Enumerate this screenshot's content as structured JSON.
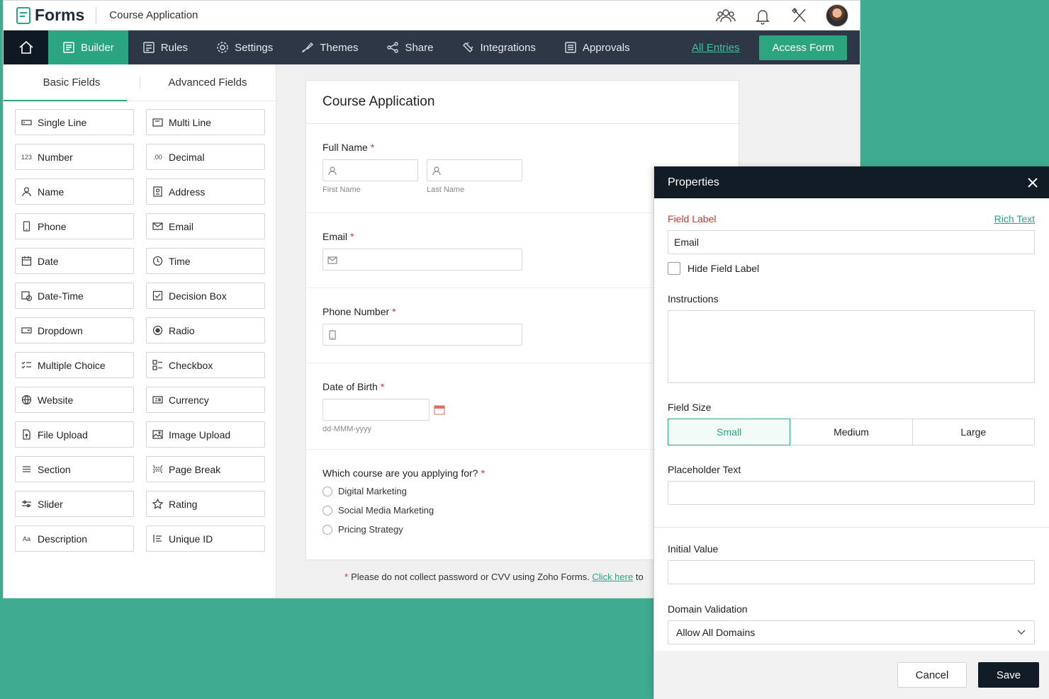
{
  "header": {
    "app_name": "Forms",
    "form_title": "Course Application"
  },
  "nav": {
    "items": [
      {
        "label": "Builder",
        "icon": "builder-icon",
        "active": true
      },
      {
        "label": "Rules",
        "icon": "rules-icon"
      },
      {
        "label": "Settings",
        "icon": "gear-icon"
      },
      {
        "label": "Themes",
        "icon": "brush-icon"
      },
      {
        "label": "Share",
        "icon": "share-icon"
      },
      {
        "label": "Integrations",
        "icon": "plug-icon"
      },
      {
        "label": "Approvals",
        "icon": "approvals-icon"
      }
    ],
    "all_entries": "All Entries",
    "access_form": "Access Form"
  },
  "fields_panel": {
    "tabs": [
      "Basic Fields",
      "Advanced Fields"
    ],
    "fields": [
      {
        "label": "Single Line",
        "icon": "single-line-icon"
      },
      {
        "label": "Multi Line",
        "icon": "multi-line-icon"
      },
      {
        "label": "Number",
        "icon": "number-icon",
        "glyph": "123"
      },
      {
        "label": "Decimal",
        "icon": "decimal-icon",
        "glyph": ".00"
      },
      {
        "label": "Name",
        "icon": "person-icon"
      },
      {
        "label": "Address",
        "icon": "address-icon"
      },
      {
        "label": "Phone",
        "icon": "phone-icon"
      },
      {
        "label": "Email",
        "icon": "envelope-icon"
      },
      {
        "label": "Date",
        "icon": "calendar-icon"
      },
      {
        "label": "Time",
        "icon": "clock-icon"
      },
      {
        "label": "Date-Time",
        "icon": "date-time-icon"
      },
      {
        "label": "Decision Box",
        "icon": "checkbox-icon"
      },
      {
        "label": "Dropdown",
        "icon": "dropdown-icon"
      },
      {
        "label": "Radio",
        "icon": "radio-icon"
      },
      {
        "label": "Multiple Choice",
        "icon": "multiple-choice-icon"
      },
      {
        "label": "Checkbox",
        "icon": "checklist-icon"
      },
      {
        "label": "Website",
        "icon": "globe-icon"
      },
      {
        "label": "Currency",
        "icon": "currency-icon"
      },
      {
        "label": "File Upload",
        "icon": "file-upload-icon"
      },
      {
        "label": "Image Upload",
        "icon": "image-upload-icon"
      },
      {
        "label": "Section",
        "icon": "section-icon"
      },
      {
        "label": "Page Break",
        "icon": "page-break-icon"
      },
      {
        "label": "Slider",
        "icon": "slider-icon"
      },
      {
        "label": "Rating",
        "icon": "star-icon"
      },
      {
        "label": "Description",
        "icon": "description-icon",
        "glyph": "Aa"
      },
      {
        "label": "Unique ID",
        "icon": "unique-id-icon"
      }
    ]
  },
  "form": {
    "title": "Course Application",
    "full_name": {
      "label": "Full Name",
      "first": "First Name",
      "last": "Last Name"
    },
    "email": {
      "label": "Email"
    },
    "phone": {
      "label": "Phone Number"
    },
    "dob": {
      "label": "Date of Birth",
      "format": "dd-MMM-yyyy"
    },
    "course": {
      "label": "Which course are you applying for?",
      "options": [
        "Digital Marketing",
        "Social Media Marketing",
        "Pricing Strategy"
      ]
    },
    "required_mark": "*"
  },
  "footnote": {
    "star": "*",
    "text": "Please do not collect password or CVV using Zoho Forms.",
    "link": "Click here",
    "tail": "to"
  },
  "properties": {
    "title": "Properties",
    "field_label": "Field Label",
    "rich_text": "Rich Text",
    "field_label_value": "Email",
    "hide_field_label": "Hide Field Label",
    "instructions": "Instructions",
    "field_size": "Field Size",
    "sizes": [
      "Small",
      "Medium",
      "Large"
    ],
    "selected_size": "Small",
    "placeholder_text": "Placeholder Text",
    "initial_value": "Initial Value",
    "domain_validation": "Domain Validation",
    "domain_value": "Allow All Domains",
    "cancel": "Cancel",
    "save": "Save"
  },
  "colors": {
    "accent": "#2aa580",
    "nav_bg": "#2d3746",
    "dark": "#121c27",
    "required": "#e0322b",
    "field_label_red": "#d0352c"
  }
}
